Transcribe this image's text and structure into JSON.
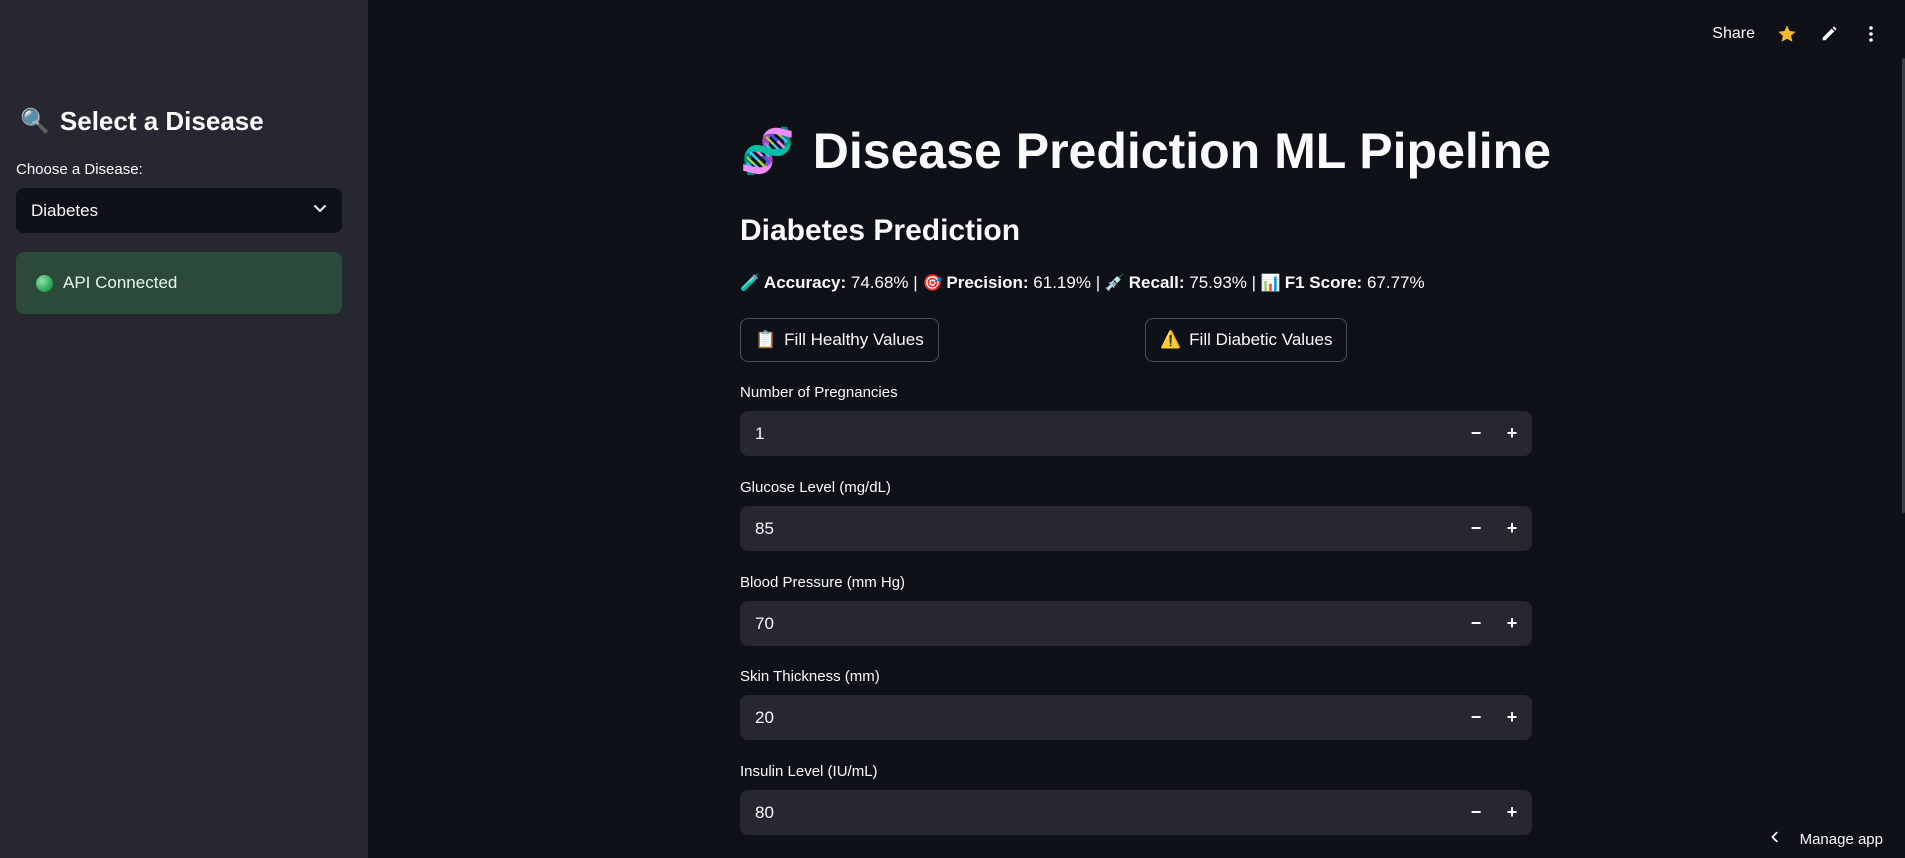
{
  "sidebar": {
    "title_emoji": "🔍",
    "title": "Select a Disease",
    "select_label": "Choose a Disease:",
    "select_value": "Diabetes",
    "status_text": "API Connected"
  },
  "toolbar": {
    "share_label": "Share",
    "icons": [
      "star-icon",
      "edit-icon",
      "more-vert-icon"
    ]
  },
  "main": {
    "title_emoji": "🧬",
    "title": "Disease Prediction ML Pipeline",
    "subtitle": "Diabetes Prediction",
    "metrics": [
      {
        "emoji": "🧪",
        "label": "Accuracy:",
        "value": "74.68%"
      },
      {
        "emoji": "🎯",
        "label": "Precision:",
        "value": "61.19%"
      },
      {
        "emoji": "💉",
        "label": "Recall:",
        "value": "75.93%"
      },
      {
        "emoji": "📊",
        "label": "F1 Score:",
        "value": "67.77%"
      }
    ],
    "separator": "|",
    "buttons": {
      "healthy_emoji": "📋",
      "healthy_label": "Fill Healthy Values",
      "diabetic_emoji": "⚠️",
      "diabetic_label": "Fill Diabetic Values"
    },
    "fields": [
      {
        "label": "Number of Pregnancies",
        "value": "1"
      },
      {
        "label": "Glucose Level (mg/dL)",
        "value": "85"
      },
      {
        "label": "Blood Pressure (mm Hg)",
        "value": "70"
      },
      {
        "label": "Skin Thickness (mm)",
        "value": "20"
      },
      {
        "label": "Insulin Level (IU/mL)",
        "value": "80"
      }
    ],
    "stepper_minus": "−",
    "stepper_plus": "+"
  },
  "footer": {
    "manage_label": "Manage app"
  },
  "colors": {
    "background": "#0e1117",
    "sidebar": "#262730",
    "status_bg": "#2b4a3a",
    "input_bg": "#262730",
    "star": "#f5b92e"
  }
}
